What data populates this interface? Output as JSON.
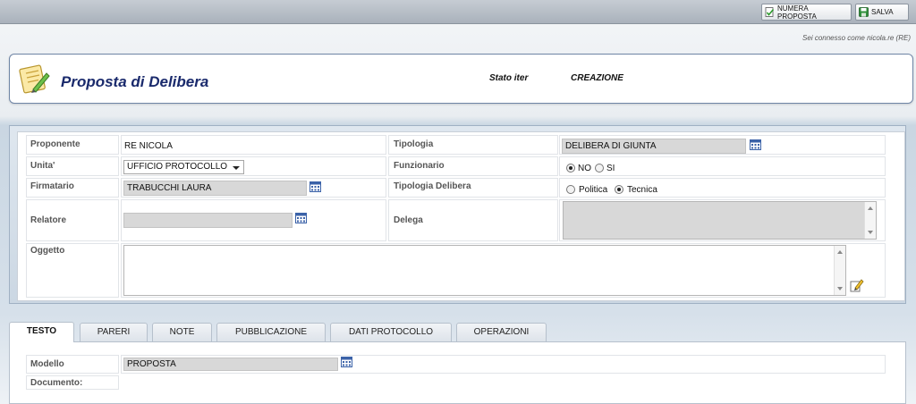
{
  "toolbar": {
    "numera_label": "NUMERA PROPOSTA",
    "salva_label": "SALVA"
  },
  "connection_text": "Sei connesso come nicola.re (RE)",
  "header": {
    "title": "Proposta di Delibera",
    "stato_label": "Stato iter",
    "stato_value": "CREAZIONE"
  },
  "form": {
    "proponente_label": "Proponente",
    "proponente_value": "RE  NICOLA",
    "tipologia_label": "Tipologia",
    "tipologia_value": "DELIBERA DI GIUNTA",
    "unita_label": "Unita'",
    "unita_value": "UFFICIO PROTOCOLLO",
    "funzionario_label": "Funzionario",
    "funzionario_options": [
      "NO",
      "SI"
    ],
    "funzionario_selected": "NO",
    "firmatario_label": "Firmatario",
    "firmatario_value": "TRABUCCHI LAURA",
    "tipologia_delibera_label": "Tipologia Delibera",
    "tipologia_delibera_options": [
      "Politica",
      "Tecnica"
    ],
    "tipologia_delibera_selected": "Tecnica",
    "relatore_label": "Relatore",
    "relatore_value": "",
    "delega_label": "Delega",
    "oggetto_label": "Oggetto",
    "oggetto_value": ""
  },
  "tabs": [
    {
      "label": "TESTO",
      "active": true
    },
    {
      "label": "PARERI",
      "active": false
    },
    {
      "label": "NOTE",
      "active": false
    },
    {
      "label": "PUBBLICAZIONE",
      "active": false
    },
    {
      "label": "DATI PROTOCOLLO",
      "active": false
    },
    {
      "label": "OPERAZIONI",
      "active": false
    }
  ],
  "testo": {
    "modello_label": "Modello",
    "modello_value": "PROPOSTA",
    "documento_label": "Documento:"
  },
  "icons": {
    "calendar": "calendar-icon",
    "edit": "edit-icon",
    "save": "save-icon",
    "numbering": "check-document-icon",
    "logo": "notepad-pencil-icon"
  },
  "colors": {
    "title": "#1a2a6c",
    "field_grey": "#d8d8d8",
    "panel_border": "#6f85a6"
  }
}
